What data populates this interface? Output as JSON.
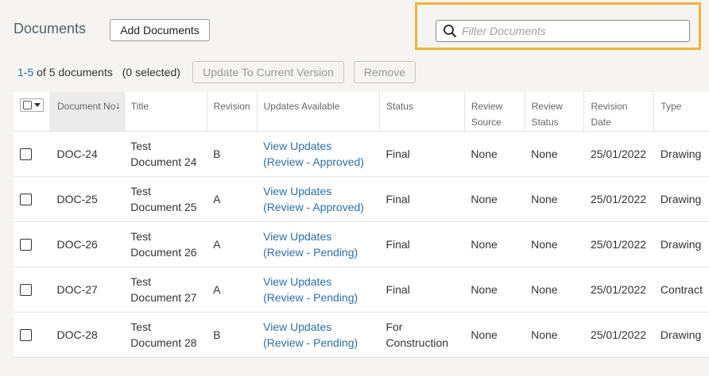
{
  "header": {
    "title": "Documents",
    "add_button": "Add Documents"
  },
  "filter": {
    "placeholder": "Filter Documents",
    "icon": "search-icon"
  },
  "status": {
    "range": "1-5",
    "of_text": "of 5 documents",
    "selected": "(0 selected)"
  },
  "actions": {
    "update": "Update To Current Version",
    "remove": "Remove"
  },
  "columns": {
    "doc_no": "Document No",
    "title": "Title",
    "revision": "Revision",
    "updates": "Updates Available",
    "status": "Status",
    "review_source": "Review Source",
    "review_status": "Review Status",
    "revision_date": "Revision Date",
    "type": "Type"
  },
  "rows": [
    {
      "doc_no": "DOC-24",
      "title": "Test Document 24",
      "revision": "B",
      "updates_link": "View Updates",
      "updates_sub": "(Review - Approved)",
      "status": "Final",
      "review_source": "None",
      "review_status": "None",
      "revision_date": "25/01/2022",
      "type": "Drawing"
    },
    {
      "doc_no": "DOC-25",
      "title": "Test Document 25",
      "revision": "A",
      "updates_link": "View Updates",
      "updates_sub": "(Review - Approved)",
      "status": "Final",
      "review_source": "None",
      "review_status": "None",
      "revision_date": "25/01/2022",
      "type": "Drawing"
    },
    {
      "doc_no": "DOC-26",
      "title": "Test Document 26",
      "revision": "A",
      "updates_link": "View Updates",
      "updates_sub": "(Review - Pending)",
      "status": "Final",
      "review_source": "None",
      "review_status": "None",
      "revision_date": "25/01/2022",
      "type": "Drawing"
    },
    {
      "doc_no": "DOC-27",
      "title": "Test Document 27",
      "revision": "A",
      "updates_link": "View Updates",
      "updates_sub": "(Review - Pending)",
      "status": "Final",
      "review_source": "None",
      "review_status": "None",
      "revision_date": "25/01/2022",
      "type": "Contract"
    },
    {
      "doc_no": "DOC-28",
      "title": "Test Document 28",
      "revision": "B",
      "updates_link": "View Updates",
      "updates_sub": "(Review - Pending)",
      "status": "For Construction",
      "review_source": "None",
      "review_status": "None",
      "revision_date": "25/01/2022",
      "type": "Drawing"
    }
  ],
  "colors": {
    "link": "#2d6ea8",
    "highlight": "#f0b43a",
    "background": "#f5f4f2"
  }
}
